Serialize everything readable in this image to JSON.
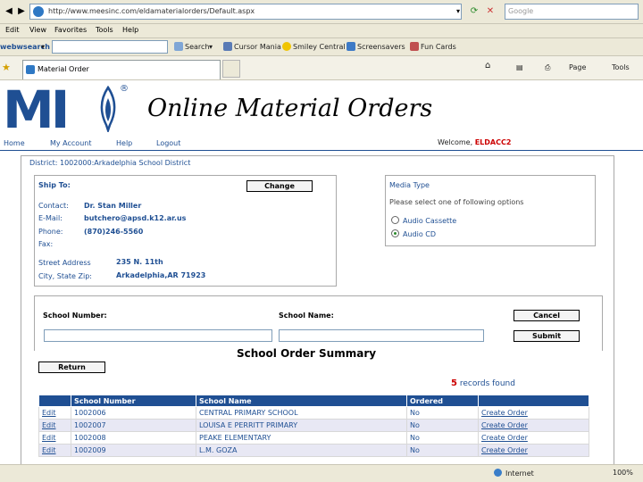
{
  "browser": {
    "address": "http://www.meesinc.com/eldamaterialorders/Default.aspx",
    "search_placeholder": "Google",
    "menu": [
      "Edit",
      "View",
      "Favorites",
      "Tools",
      "Help"
    ],
    "toolbar_brand": "webwsearch",
    "toolbar_items": [
      {
        "label": "Search",
        "icon": "search-icon"
      },
      {
        "label": "Cursor Mania",
        "icon": "cursor-icon"
      },
      {
        "label": "Smiley Central",
        "icon": "smiley-icon"
      },
      {
        "label": "Screensavers",
        "icon": "screensaver-icon"
      },
      {
        "label": "Fun Cards",
        "icon": "card-icon"
      }
    ],
    "tab_label": "Material Order",
    "tab_tools": [
      "Page",
      "Tools"
    ],
    "status_zone": "Internet",
    "zoom": "100%"
  },
  "header": {
    "logo": "MI",
    "title": "Online Material Orders",
    "nav": [
      "Home",
      "My Account",
      "Help",
      "Logout"
    ],
    "welcome_prefix": "Welcome,",
    "user": "ELDACC2"
  },
  "district": "District: 1002000:Arkadelphia School District",
  "ship_to": {
    "heading": "Ship To:",
    "change_label": "Change",
    "contact_label": "Contact:",
    "contact": "Dr. Stan Miller",
    "email_label": "E-Mail:",
    "email": "butchero@apsd.k12.ar.us",
    "phone_label": "Phone:",
    "phone": "(870)246-5560",
    "fax_label": "Fax:",
    "street_label": "Street Address",
    "street": "235 N. 11th",
    "city_label": "City, State Zip:",
    "city": "Arkadelphia,AR 71923"
  },
  "media": {
    "heading": "Media Type",
    "prompt": "Please select one of following options",
    "options": [
      "Audio Cassette",
      "Audio CD"
    ],
    "selected": "Audio CD"
  },
  "search_form": {
    "school_number_label": "School Number:",
    "school_name_label": "School Name:",
    "cancel_label": "Cancel",
    "submit_label": "Submit",
    "return_label": "Return"
  },
  "summary": {
    "title": "School Order Summary",
    "count": "5",
    "count_suffix": "records found",
    "columns": [
      "",
      "School Number",
      "School Name",
      "Ordered",
      ""
    ],
    "rows": [
      {
        "edit": "Edit",
        "number": "1002006",
        "name": "CENTRAL PRIMARY SCHOOL",
        "ordered": "No",
        "action": "Create Order"
      },
      {
        "edit": "Edit",
        "number": "1002007",
        "name": "LOUISA E PERRITT PRIMARY",
        "ordered": "No",
        "action": "Create Order"
      },
      {
        "edit": "Edit",
        "number": "1002008",
        "name": "PEAKE ELEMENTARY",
        "ordered": "No",
        "action": "Create Order"
      },
      {
        "edit": "Edit",
        "number": "1002009",
        "name": "L.M. GOZA",
        "ordered": "No",
        "action": "Create Order"
      }
    ]
  }
}
